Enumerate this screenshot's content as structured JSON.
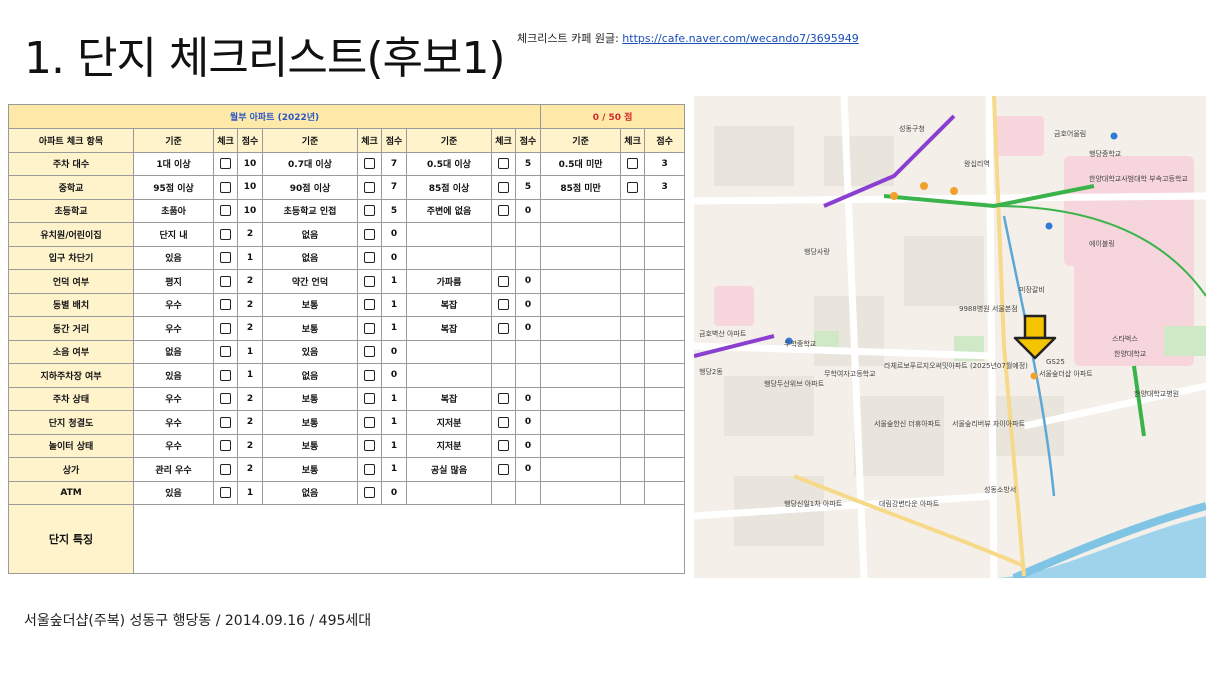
{
  "title": "1. 단지 체크리스트(후보1)",
  "source": {
    "label": "체크리스트 카페 원글:",
    "url": "https://cafe.naver.com/wecando7/3695949"
  },
  "checklist": {
    "title": "월부 아파트 (2022년)",
    "score": "0 / 50 점",
    "headers": [
      "아파트 체크 항목",
      "기준",
      "체크",
      "점수",
      "기준",
      "체크",
      "점수",
      "기준",
      "체크",
      "점수",
      "기준",
      "체크",
      "점수"
    ],
    "rows": [
      {
        "item": "주차 대수",
        "c1": "1대 이상",
        "s1": "10",
        "c2": "0.7대 이상",
        "s2": "7",
        "c3": "0.5대 이상",
        "s3": "5",
        "c4": "0.5대 미만",
        "s4": "3"
      },
      {
        "item": "중학교",
        "c1": "95점 이상",
        "s1": "10",
        "c2": "90점 이상",
        "s2": "7",
        "c3": "85점 이상",
        "s3": "5",
        "c4": "85점 미만",
        "s4": "3"
      },
      {
        "item": "초등학교",
        "c1": "초품아",
        "s1": "10",
        "c2": "초등학교 인접",
        "s2": "5",
        "c3": "주변에 없음",
        "s3": "0",
        "c4": "",
        "s4": ""
      },
      {
        "item": "유치원/어린이집",
        "c1": "단지 내",
        "s1": "2",
        "c2": "없음",
        "s2": "0",
        "c3": "",
        "s3": "",
        "c4": "",
        "s4": ""
      },
      {
        "item": "입구 차단기",
        "c1": "있음",
        "s1": "1",
        "c2": "없음",
        "s2": "0",
        "c3": "",
        "s3": "",
        "c4": "",
        "s4": ""
      },
      {
        "item": "언덕 여부",
        "c1": "평지",
        "s1": "2",
        "c2": "약간 언덕",
        "s2": "1",
        "c3": "가파름",
        "s3": "0",
        "c4": "",
        "s4": ""
      },
      {
        "item": "동별 배치",
        "c1": "우수",
        "s1": "2",
        "c2": "보통",
        "s2": "1",
        "c3": "복잡",
        "s3": "0",
        "c4": "",
        "s4": ""
      },
      {
        "item": "동간 거리",
        "c1": "우수",
        "s1": "2",
        "c2": "보통",
        "s2": "1",
        "c3": "복잡",
        "s3": "0",
        "c4": "",
        "s4": ""
      },
      {
        "item": "소음 여부",
        "c1": "없음",
        "s1": "1",
        "c2": "있음",
        "s2": "0",
        "c3": "",
        "s3": "",
        "c4": "",
        "s4": ""
      },
      {
        "item": "지하주차장 여부",
        "c1": "있음",
        "s1": "1",
        "c2": "없음",
        "s2": "0",
        "c3": "",
        "s3": "",
        "c4": "",
        "s4": ""
      },
      {
        "item": "주차 상태",
        "c1": "우수",
        "s1": "2",
        "c2": "보통",
        "s2": "1",
        "c3": "복잡",
        "s3": "0",
        "c4": "",
        "s4": ""
      },
      {
        "item": "단지 청결도",
        "c1": "우수",
        "s1": "2",
        "c2": "보통",
        "s2": "1",
        "c3": "지저분",
        "s3": "0",
        "c4": "",
        "s4": ""
      },
      {
        "item": "놀이터 상태",
        "c1": "우수",
        "s1": "2",
        "c2": "보통",
        "s2": "1",
        "c3": "지저분",
        "s3": "0",
        "c4": "",
        "s4": ""
      },
      {
        "item": "상가",
        "c1": "관리 우수",
        "s1": "2",
        "c2": "보통",
        "s2": "1",
        "c3": "공실 많음",
        "s3": "0",
        "c4": "",
        "s4": ""
      },
      {
        "item": "ATM",
        "c1": "있음",
        "s1": "1",
        "c2": "없음",
        "s2": "0",
        "c3": "",
        "s3": "",
        "c4": "",
        "s4": ""
      }
    ],
    "feature_label": "단지 특징"
  },
  "map": {
    "labels": [
      "성동구청",
      "금호어울림",
      "행당중학교",
      "한양대학교사범대학 부속고등학교",
      "왕십리역",
      "서울숲더샵 아파트",
      "GS25",
      "라체르보푸르지오써밋아파트 (2025년07월예정)",
      "행당2동",
      "행당두산위브 아파트",
      "서울숲리버뷰 자이아파트",
      "대림강변타운 아파트",
      "무학여자고등학교",
      "서울숲한신 더휴아파트",
      "성동소방서",
      "한양대학교",
      "한양대학교병원",
      "행당신일1차 아파트",
      "미장갈비",
      "스타벅스",
      "에이블링",
      "9988병원 서울본점",
      "무학중학교",
      "행당사랑",
      "금호벽산 아파트"
    ]
  },
  "footer": "서울숲더샵(주복) 성동구 행당동 / 2014.09.16 / 495세대"
}
